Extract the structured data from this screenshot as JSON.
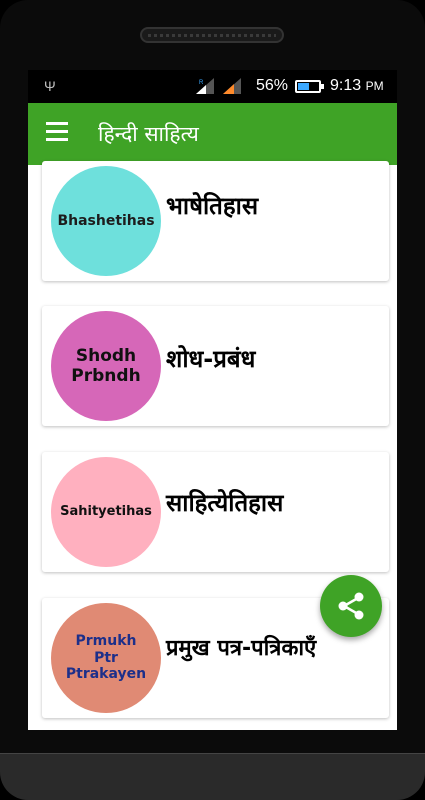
{
  "status_bar": {
    "battery_percent": "56%",
    "battery_level": 0.56,
    "time": "9:13",
    "ampm": "PM",
    "icons": [
      "usb-icon",
      "signal-r-icon",
      "signal-icon",
      "battery-icon"
    ]
  },
  "app_bar": {
    "title": "हिन्दी साहित्य",
    "menu_icon": "hamburger-menu-icon"
  },
  "items": [
    {
      "circle_text": "Bhashetihas",
      "label": "भाषेतिहास",
      "color": "#6ee0dc"
    },
    {
      "circle_text": "Shodh\nPrbndh",
      "label": "शोध-प्रबंध",
      "color": "#d667b8"
    },
    {
      "circle_text": "Sahityetihas",
      "label": "साहित्येतिहास",
      "color": "#ffb0bf"
    },
    {
      "circle_text": "Prmukh\nPtr\nPtrakayen",
      "label": "प्रमुख पत्र-पत्रिकाएँ",
      "color": "#e08a74"
    }
  ],
  "fab": {
    "icon": "share-icon",
    "color": "#3fa326"
  },
  "colors": {
    "accent": "#3fa326",
    "circle_text_blue": "#1d2f8a"
  }
}
